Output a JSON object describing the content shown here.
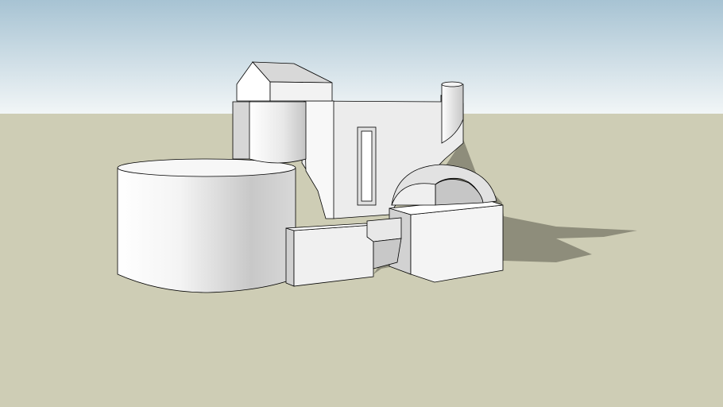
{
  "viewport": {
    "colors": {
      "sky_top": "#a7c3d3",
      "sky_horizon": "#f2f6f7",
      "ground": "#cecdb5",
      "shadow": "#8e8d7b",
      "face_light": "#ffffff",
      "face_mid": "#e4e4e4",
      "face_dark": "#bdbdbd",
      "edge": "#000000"
    }
  }
}
